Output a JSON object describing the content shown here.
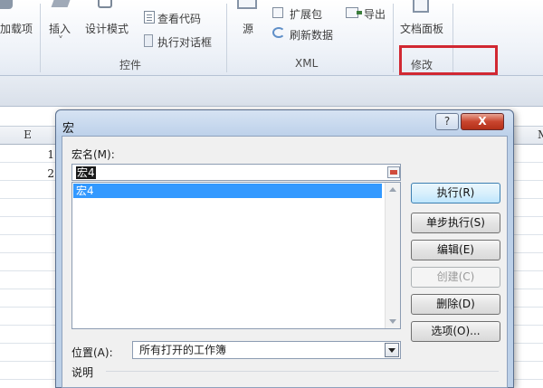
{
  "ribbon": {
    "addins_label": "加载项",
    "insert_label": "插入",
    "design_mode_label": "设计模式",
    "view_code_label": "查看代码",
    "run_dialog_label": "执行对话框",
    "controls_group": "控件",
    "source_label": "源",
    "expansion_pack_label": "扩展包",
    "refresh_data_label": "刷新数据",
    "export_label": "导出",
    "xml_group": "XML",
    "doc_panel_label": "文档面板",
    "modify_group": "修改"
  },
  "sheet": {
    "col_e": "E",
    "col_m": "M",
    "cell_e1": "1",
    "cell_e2": "2"
  },
  "dialog": {
    "title": "宏",
    "help_label": "?",
    "close_label": "X",
    "macro_name_label": "宏名(M):",
    "macro_name_value": "宏4",
    "macro_list": [
      "宏4"
    ],
    "location_label": "位置(A):",
    "location_value": "所有打开的工作簿",
    "description_label": "说明",
    "buttons": {
      "run": "执行(R)",
      "step_into": "单步执行(S)",
      "edit": "编辑(E)",
      "create": "创建(C)",
      "delete": "删除(D)",
      "options": "选项(O)..."
    }
  },
  "colors": {
    "highlight": "#d12832",
    "selection": "#3399ff",
    "close_button": "#c9452e"
  }
}
